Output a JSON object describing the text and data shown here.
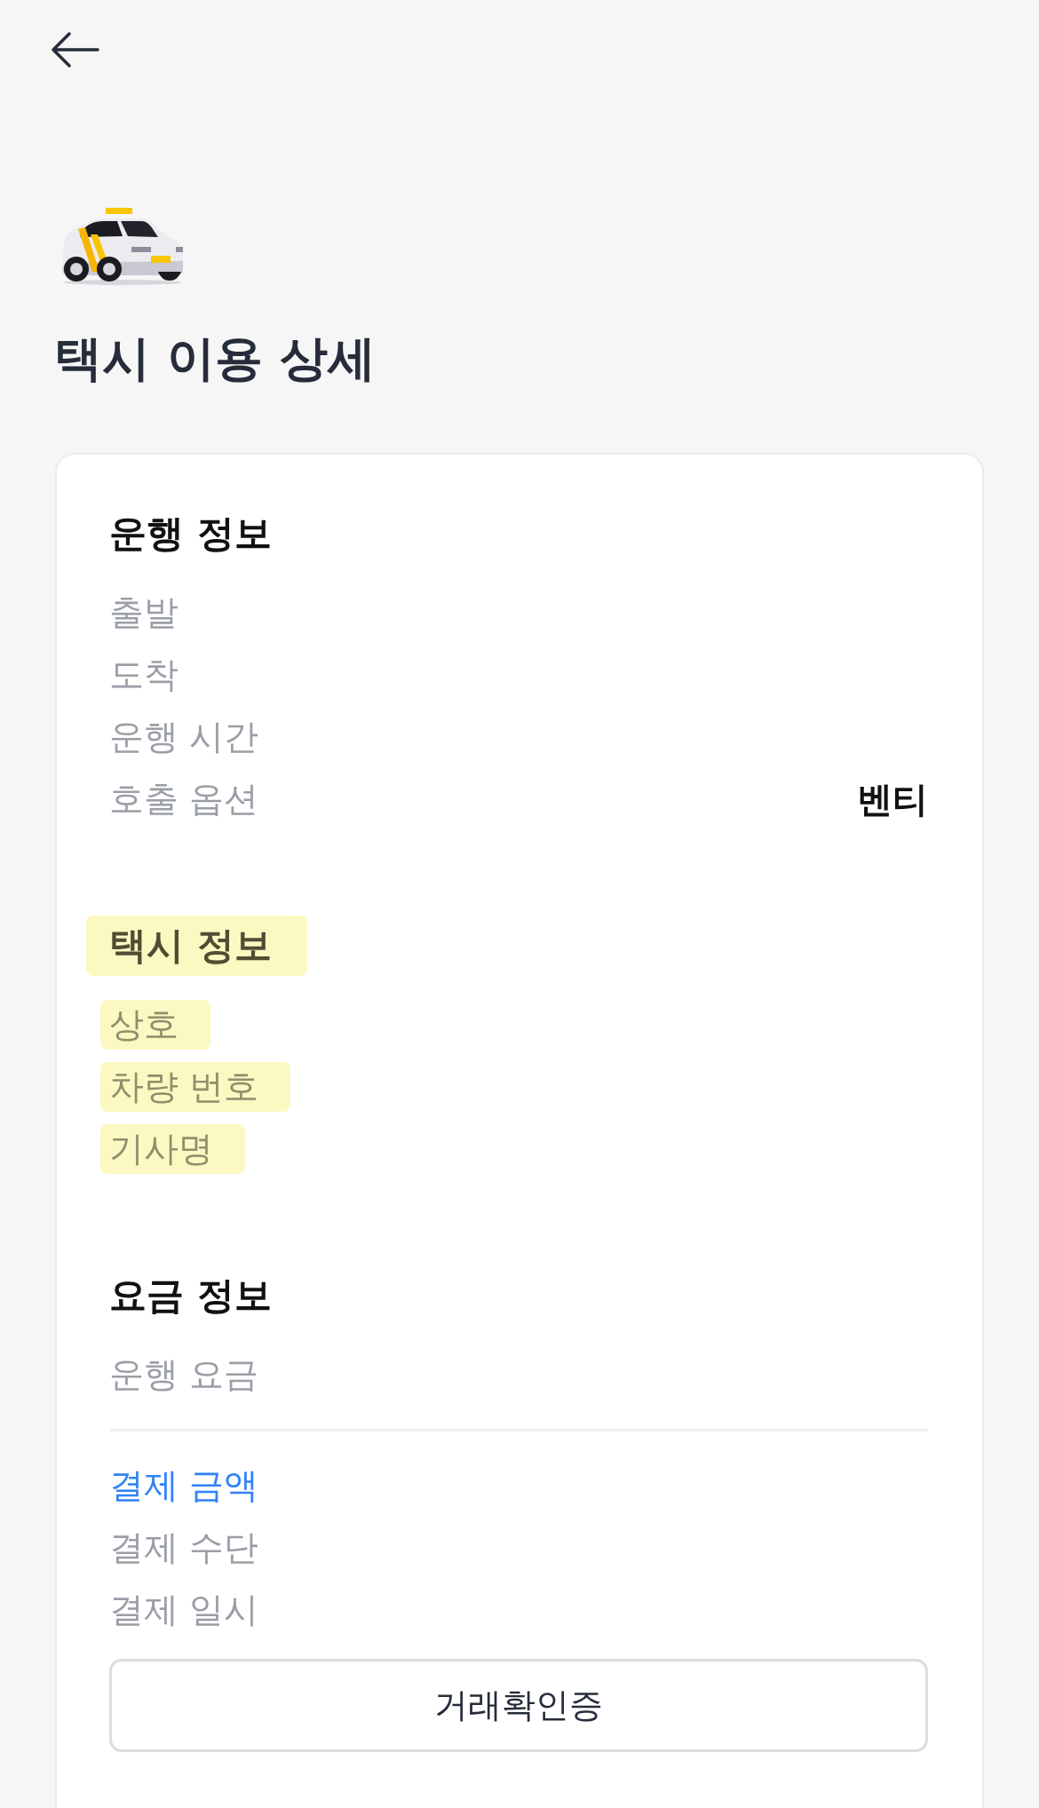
{
  "header": {
    "title": "택시 이용 상세"
  },
  "sections": [
    {
      "title": "운행 정보",
      "highlighted": false,
      "rows": [
        {
          "label": "출발",
          "highlighted": false
        },
        {
          "label": "도착",
          "highlighted": false
        },
        {
          "label": "운행 시간",
          "highlighted": false
        },
        {
          "label": "호출 옵션",
          "value": "벤티",
          "highlighted": false
        }
      ]
    },
    {
      "title": "택시 정보",
      "highlighted": true,
      "rows": [
        {
          "label": "상호",
          "highlighted": true
        },
        {
          "label": "차량 번호",
          "highlighted": true
        },
        {
          "label": "기사명",
          "highlighted": true
        }
      ]
    },
    {
      "title": "요금 정보",
      "highlighted": false,
      "rows": [
        {
          "label": "운행 요금",
          "highlighted": false
        }
      ],
      "totals": [
        {
          "kind": "accent",
          "label": "결제 금액",
          "highlighted": false
        },
        {
          "kind": "plain",
          "label": "결제 수단",
          "highlighted": false
        },
        {
          "kind": "plain",
          "label": "결제 일시",
          "highlighted": false
        }
      ]
    }
  ],
  "button": {
    "label": "거래확인증"
  }
}
